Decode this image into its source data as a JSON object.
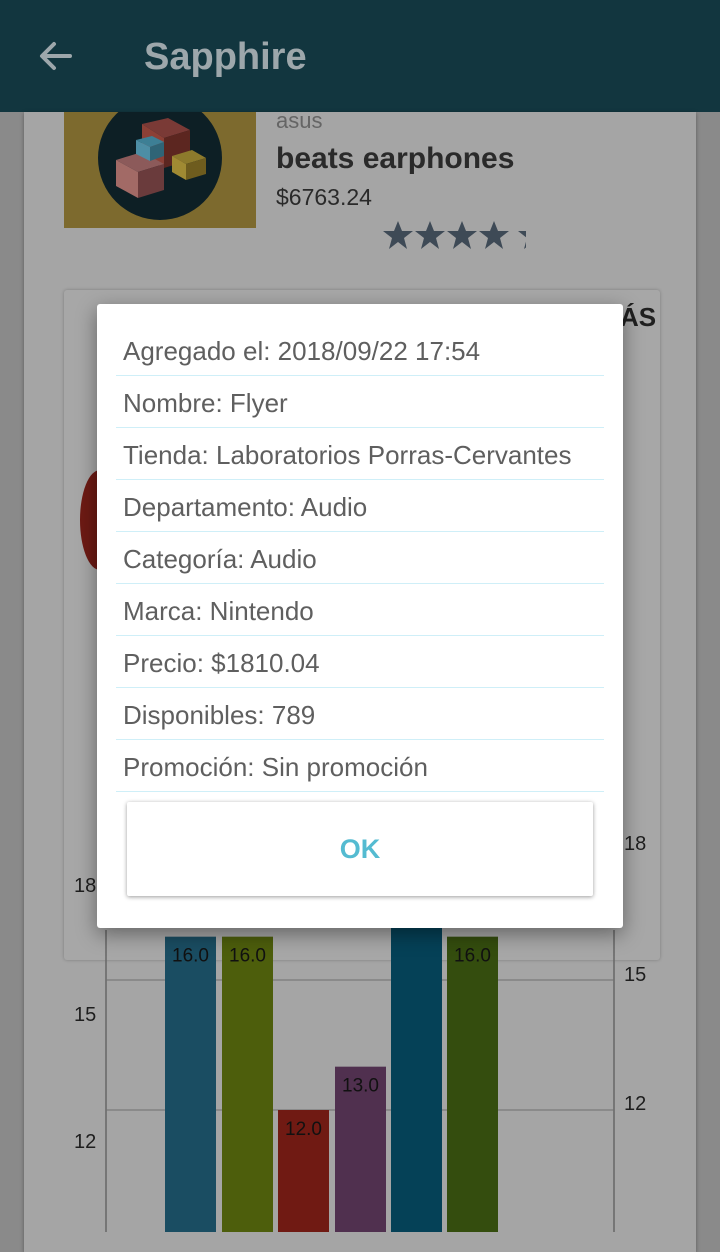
{
  "app": {
    "title": "Sapphire",
    "back_icon": "arrow-back-icon"
  },
  "product": {
    "brand": "asus",
    "name": "beats earphones",
    "price": "$6763.24",
    "rating": 4.5,
    "image_icon": "cubes-icon"
  },
  "background": {
    "fragment_text": "ÁS"
  },
  "chart_data": {
    "type": "bar",
    "y_ticks_left": [
      "18",
      "15",
      "12"
    ],
    "y_ticks_right": [
      "18",
      "15",
      "12"
    ],
    "series": [
      {
        "values": [
          16.0
        ],
        "color": "#1a4d62"
      },
      {
        "values": [
          16.0
        ],
        "color": "#4d5e0c"
      },
      {
        "values": [
          12.0
        ],
        "color": "#701a13"
      },
      {
        "values": [
          13.0
        ],
        "color": "#50304f"
      },
      {
        "values": [
          18.0
        ],
        "color": "#054157"
      },
      {
        "values": [
          16.0
        ],
        "color": "#344d0e"
      }
    ],
    "data_labels": [
      "16.0",
      "16.0",
      "12.0",
      "13.0",
      "",
      "16.0"
    ],
    "grid": true
  },
  "dialog": {
    "rows": [
      "Agregado el: 2018/09/22 17:54",
      "Nombre: Flyer",
      "Tienda: Laboratorios Porras-Cervantes",
      "Departamento: Audio",
      "Categoría: Audio",
      "Marca: Nintendo",
      "Precio: $1810.04",
      "Disponibles: 789",
      "Promoción: Sin promoción"
    ],
    "ok_label": "OK"
  },
  "colors": {
    "appbar": "#12363f",
    "accent": "#54bbd1"
  }
}
